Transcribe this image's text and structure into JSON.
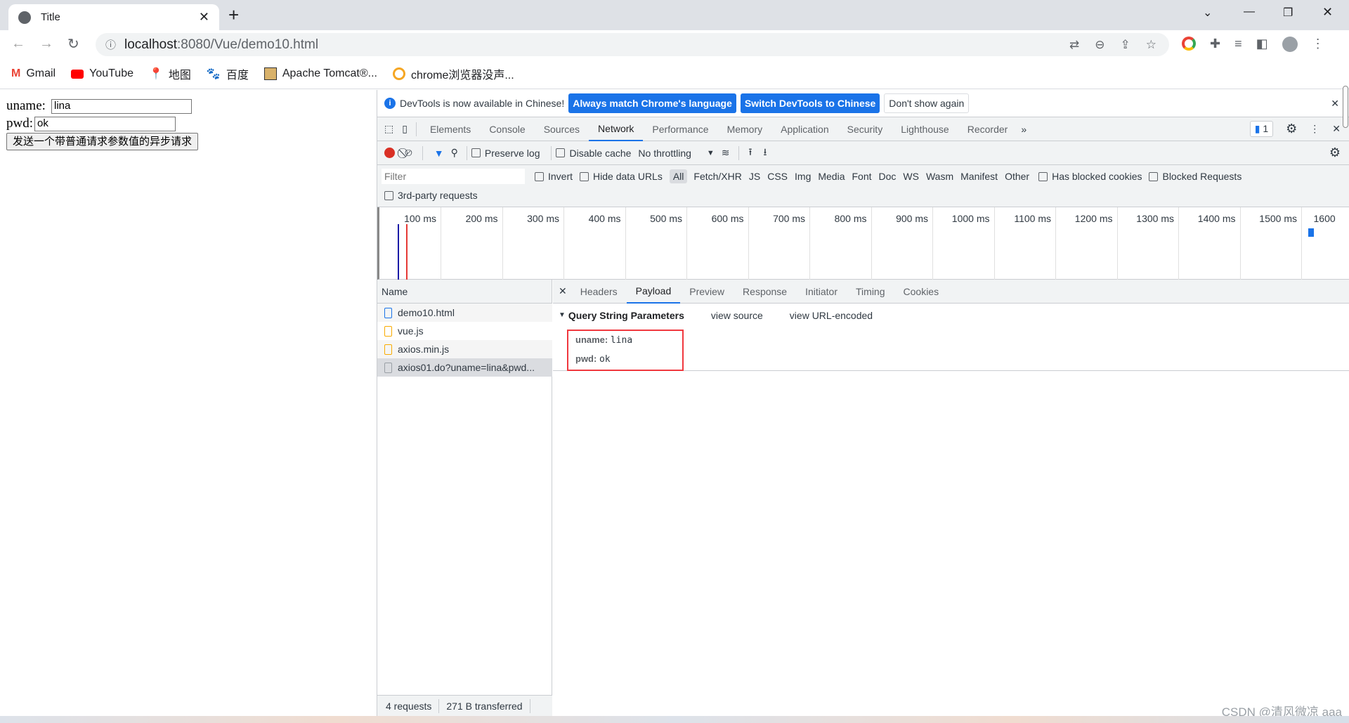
{
  "browser": {
    "tab_title": "Title",
    "url_host": "localhost",
    "url_rest": ":8080/Vue/demo10.html",
    "bookmarks": [
      {
        "label": "Gmail",
        "icon": "gmail-icon"
      },
      {
        "label": "YouTube",
        "icon": "youtube-icon"
      },
      {
        "label": "地图",
        "icon": "maps-icon"
      },
      {
        "label": "百度",
        "icon": "baidu-icon"
      },
      {
        "label": "Apache Tomcat®...",
        "icon": "tomcat-icon"
      },
      {
        "label": "chrome浏览器没声...",
        "icon": "bookmark-icon"
      }
    ]
  },
  "page": {
    "uname_label": "uname:",
    "uname_value": "lina",
    "pwd_label": "pwd:",
    "pwd_value": "ok",
    "submit_label": "发送一个带普通请求参数值的异步请求"
  },
  "devtools": {
    "infobar": {
      "message": "DevTools is now available in Chinese!",
      "btn1": "Always match Chrome's language",
      "btn2": "Switch DevTools to Chinese",
      "btn3": "Don't show again"
    },
    "tabs": [
      "Elements",
      "Console",
      "Sources",
      "Network",
      "Performance",
      "Memory",
      "Application",
      "Security",
      "Lighthouse",
      "Recorder"
    ],
    "active_tab": "Network",
    "issues_count": "1",
    "toolbar": {
      "preserve_log": "Preserve log",
      "disable_cache": "Disable cache",
      "throttling": "No throttling"
    },
    "filter": {
      "placeholder": "Filter",
      "invert": "Invert",
      "hide_data_urls": "Hide data URLs",
      "types": [
        "All",
        "Fetch/XHR",
        "JS",
        "CSS",
        "Img",
        "Media",
        "Font",
        "Doc",
        "WS",
        "Wasm",
        "Manifest",
        "Other"
      ],
      "has_blocked_cookies": "Has blocked cookies",
      "blocked_requests": "Blocked Requests",
      "third_party": "3rd-party requests"
    },
    "timeline": {
      "ticks": [
        "100 ms",
        "200 ms",
        "300 ms",
        "400 ms",
        "500 ms",
        "600 ms",
        "700 ms",
        "800 ms",
        "900 ms",
        "1000 ms",
        "1100 ms",
        "1200 ms",
        "1300 ms",
        "1400 ms",
        "1500 ms",
        "1600"
      ],
      "dom_content_loaded_color": "#1a1aa6",
      "load_color": "#e53935"
    },
    "name_header": "Name",
    "requests": [
      {
        "name": "demo10.html",
        "type": "document"
      },
      {
        "name": "vue.js",
        "type": "script"
      },
      {
        "name": "axios.min.js",
        "type": "script"
      },
      {
        "name": "axios01.do?uname=lina&pwd...",
        "type": "xhr",
        "selected": true
      }
    ],
    "detail_tabs": [
      "Headers",
      "Payload",
      "Preview",
      "Response",
      "Initiator",
      "Timing",
      "Cookies"
    ],
    "active_detail_tab": "Payload",
    "payload": {
      "section": "Query String Parameters",
      "view_source": "view source",
      "view_url_encoded": "view URL-encoded",
      "params": [
        {
          "key": "uname:",
          "value": "lina"
        },
        {
          "key": "pwd:",
          "value": "ok"
        }
      ]
    },
    "status": {
      "requests": "4 requests",
      "transferred": "271 B transferred"
    }
  },
  "watermark": "CSDN @清风微凉 aaa"
}
